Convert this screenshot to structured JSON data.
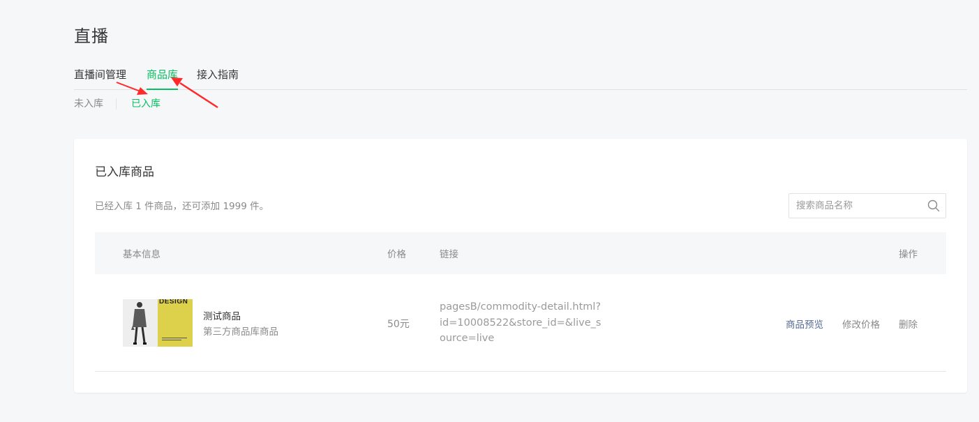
{
  "page": {
    "title": "直播"
  },
  "tabs": [
    {
      "label": "直播间管理",
      "active": false
    },
    {
      "label": "商品库",
      "active": true
    },
    {
      "label": "接入指南",
      "active": false
    }
  ],
  "subtabs": [
    {
      "label": "未入库",
      "active": false
    },
    {
      "label": "已入库",
      "active": true
    }
  ],
  "card": {
    "title": "已入库商品",
    "summary": "已经入库 1 件商品，还可添加 1999 件。",
    "search": {
      "placeholder": "搜索商品名称",
      "value": "",
      "icon": "search-icon"
    }
  },
  "table": {
    "headers": {
      "basic_info": "基本信息",
      "price": "价格",
      "link": "链接",
      "actions": "操作"
    },
    "rows": [
      {
        "thumb_text": "DESIGN",
        "name": "测试商品",
        "source": "第三方商品库商品",
        "price": "50元",
        "link": "pagesB/commodity-detail.html?id=10008522&store_id=&live_source=live",
        "actions": {
          "preview": "商品预览",
          "edit_price": "修改价格",
          "delete": "删除"
        }
      }
    ]
  },
  "colors": {
    "accent": "#07c160",
    "link_action": "#576b95",
    "annotation": "#ff2a2a"
  }
}
